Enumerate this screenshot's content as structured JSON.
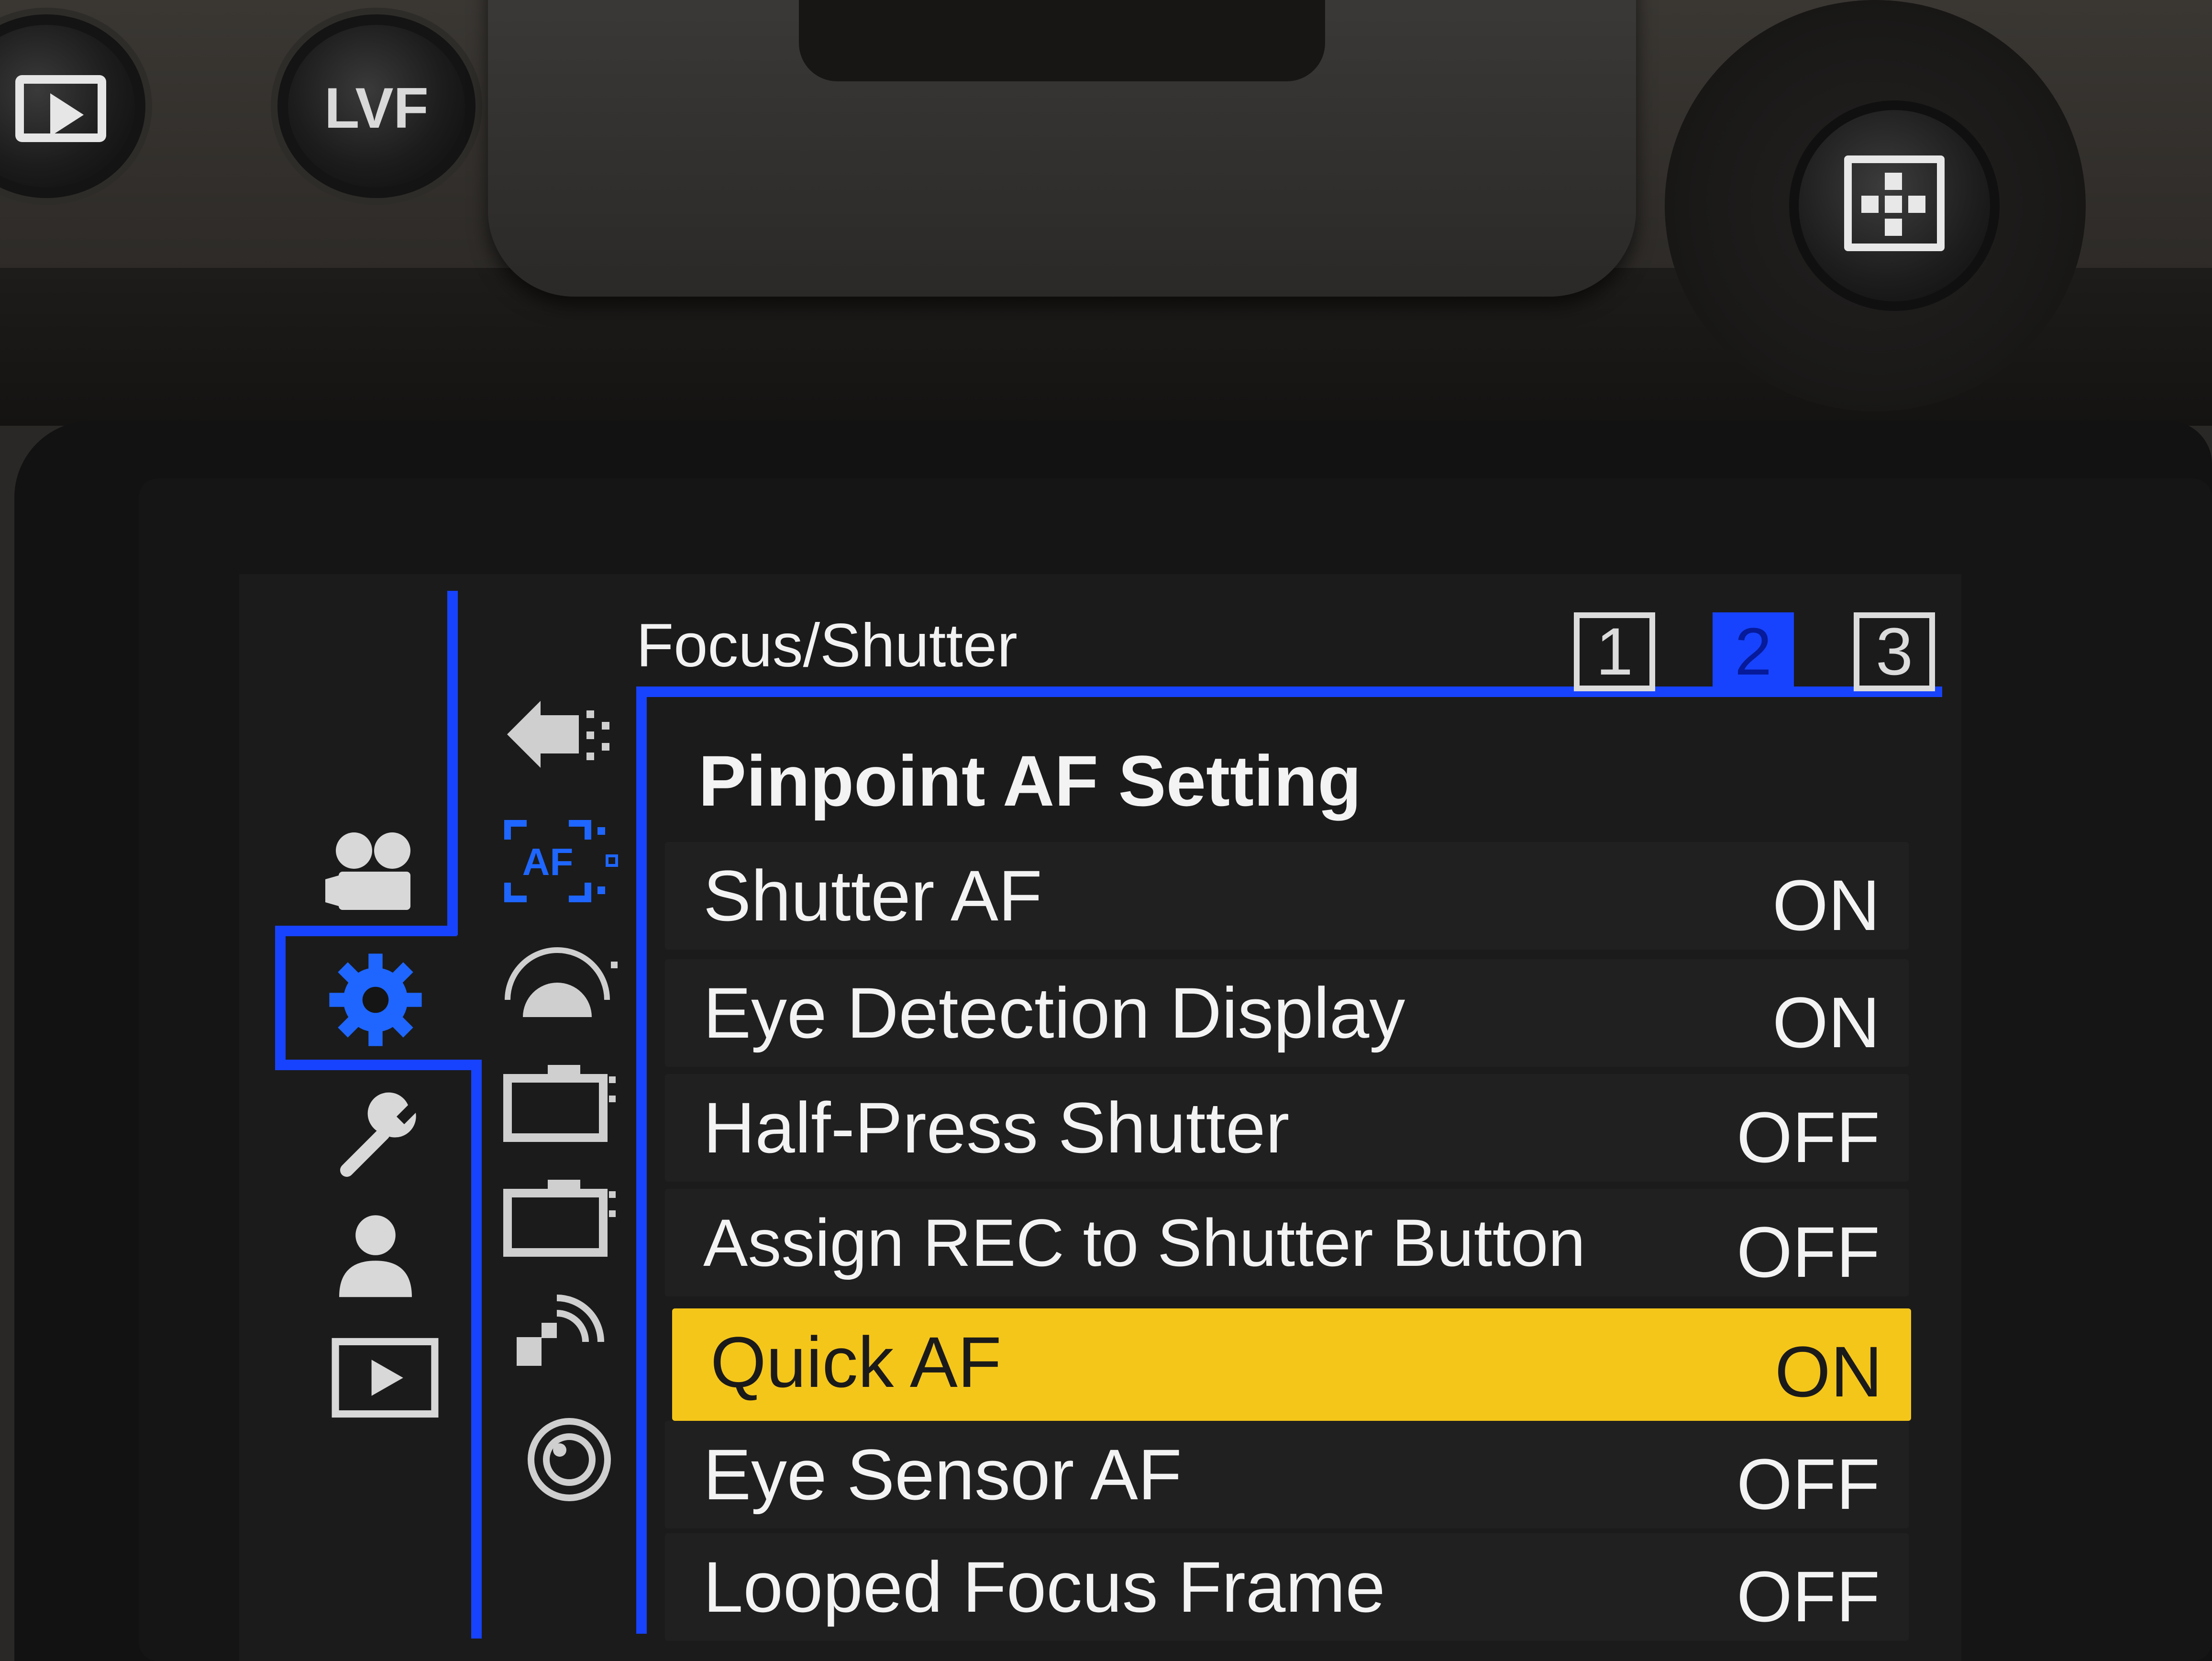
{
  "hardware": {
    "lvf_label": "LVF",
    "play_button_icon": "playback-icon",
    "joystick_icon": "joystick-af-point-icon"
  },
  "main_menu": {
    "items": [
      {
        "icon": "video-camera-icon"
      },
      {
        "icon": "gear-icon",
        "selected": true
      },
      {
        "icon": "wrench-icon"
      },
      {
        "icon": "person-icon"
      },
      {
        "icon": "playback-icon"
      }
    ]
  },
  "sub_menu": {
    "items": [
      {
        "icon": "af-area-arrow-icon"
      },
      {
        "icon": "af-icon",
        "label": "AF",
        "selected": true
      },
      {
        "icon": "exposure-meter-icon"
      },
      {
        "icon": "camera-1-icon"
      },
      {
        "icon": "camera-2-icon"
      },
      {
        "icon": "wireless-icon"
      },
      {
        "icon": "lens-icon"
      }
    ]
  },
  "menu": {
    "title": "Focus/Shutter",
    "pages": [
      "1",
      "2",
      "3"
    ],
    "current_page": "2",
    "rows": [
      {
        "label": "Pinpoint AF Setting",
        "value": ""
      },
      {
        "label": "Shutter AF",
        "value": "ON"
      },
      {
        "label": "Eye Detection Display",
        "value": "ON"
      },
      {
        "label": "Half-Press Shutter",
        "value": "OFF"
      },
      {
        "label": "Assign REC to Shutter Button",
        "value": "OFF"
      },
      {
        "label": "Quick AF",
        "value": "ON"
      },
      {
        "label": "Eye Sensor AF",
        "value": "OFF"
      },
      {
        "label": "Looped Focus Frame",
        "value": "OFF"
      }
    ],
    "selected_row": "Quick AF"
  },
  "colors": {
    "accent_blue": "#1743ff",
    "selection_yellow": "#f5c61a",
    "text": "#f3f3f3"
  }
}
